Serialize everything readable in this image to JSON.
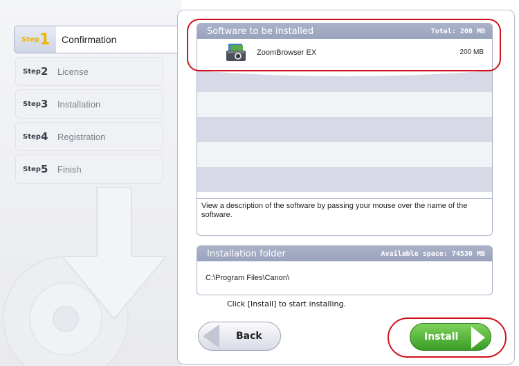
{
  "steps": [
    {
      "word": "Step",
      "num": "1",
      "label": "Confirmation"
    },
    {
      "word": "Step",
      "num": "2",
      "label": "License"
    },
    {
      "word": "Step",
      "num": "3",
      "label": "Installation"
    },
    {
      "word": "Step",
      "num": "4",
      "label": "Registration"
    },
    {
      "word": "Step",
      "num": "5",
      "label": "Finish"
    }
  ],
  "active_step": 1,
  "software_box": {
    "title": "Software to be installed",
    "total": "Total: 200 MB",
    "items": [
      {
        "name": "ZoomBrowser EX",
        "size": "200 MB",
        "icon": "camera-icon"
      }
    ],
    "description": "View a description of the software by passing your mouse over the name of the software."
  },
  "folder_box": {
    "title": "Installation folder",
    "available": "Available space: 74530 MB",
    "path": "C:\\Program Files\\Canon\\"
  },
  "prompt": "Click [Install] to start installing.",
  "buttons": {
    "back": "Back",
    "install": "Install"
  },
  "colors": {
    "header_bg": "#9aa3bd",
    "install_green": "#3a9c26",
    "highlight_red": "#d0101a",
    "active_step_yellow": "#f0b400"
  }
}
